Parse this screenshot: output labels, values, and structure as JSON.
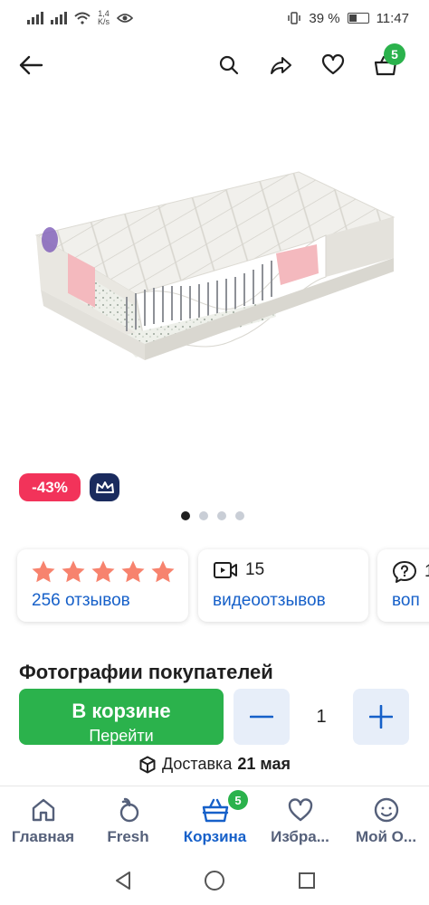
{
  "status_bar": {
    "speed_top": "1,4",
    "speed_bottom": "K/s",
    "battery": "39 %",
    "time": "11:47"
  },
  "top_bar": {
    "cart_count": "5",
    "icons": [
      "back-arrow-icon",
      "search-icon",
      "share-icon",
      "heart-icon",
      "cart-icon"
    ]
  },
  "product": {
    "discount": "-43%",
    "premium_icon": "crown-icon",
    "carousel": {
      "count": 4,
      "active_index": 0
    }
  },
  "cards": {
    "rating": {
      "stars": 5,
      "reviews": "256 отзывов"
    },
    "video": {
      "count": "15",
      "label": "видеоотзывов"
    },
    "questions": {
      "count": "1",
      "label": "воп"
    }
  },
  "section": {
    "title": "Фотографии покупателей"
  },
  "buy_bar": {
    "cart_button_line1": "В корзине",
    "cart_button_line2": "Перейти",
    "quantity": "1",
    "delivery_prefix": "Доставка",
    "delivery_date": "21 мая"
  },
  "tab_bar": {
    "cart_badge": "5",
    "items": [
      {
        "label": "Главная",
        "icon": "home-icon"
      },
      {
        "label": "Fresh",
        "icon": "fresh-icon"
      },
      {
        "label": "Корзина",
        "icon": "basket-icon"
      },
      {
        "label": "Избра...",
        "icon": "heart-icon"
      },
      {
        "label": "Мой О...",
        "icon": "profile-icon"
      }
    ]
  },
  "colors": {
    "green": "#2bb24c",
    "blue": "#1660c9",
    "discount": "#f2335a",
    "navy": "#1a2b5e",
    "stars": "#f7836e"
  }
}
